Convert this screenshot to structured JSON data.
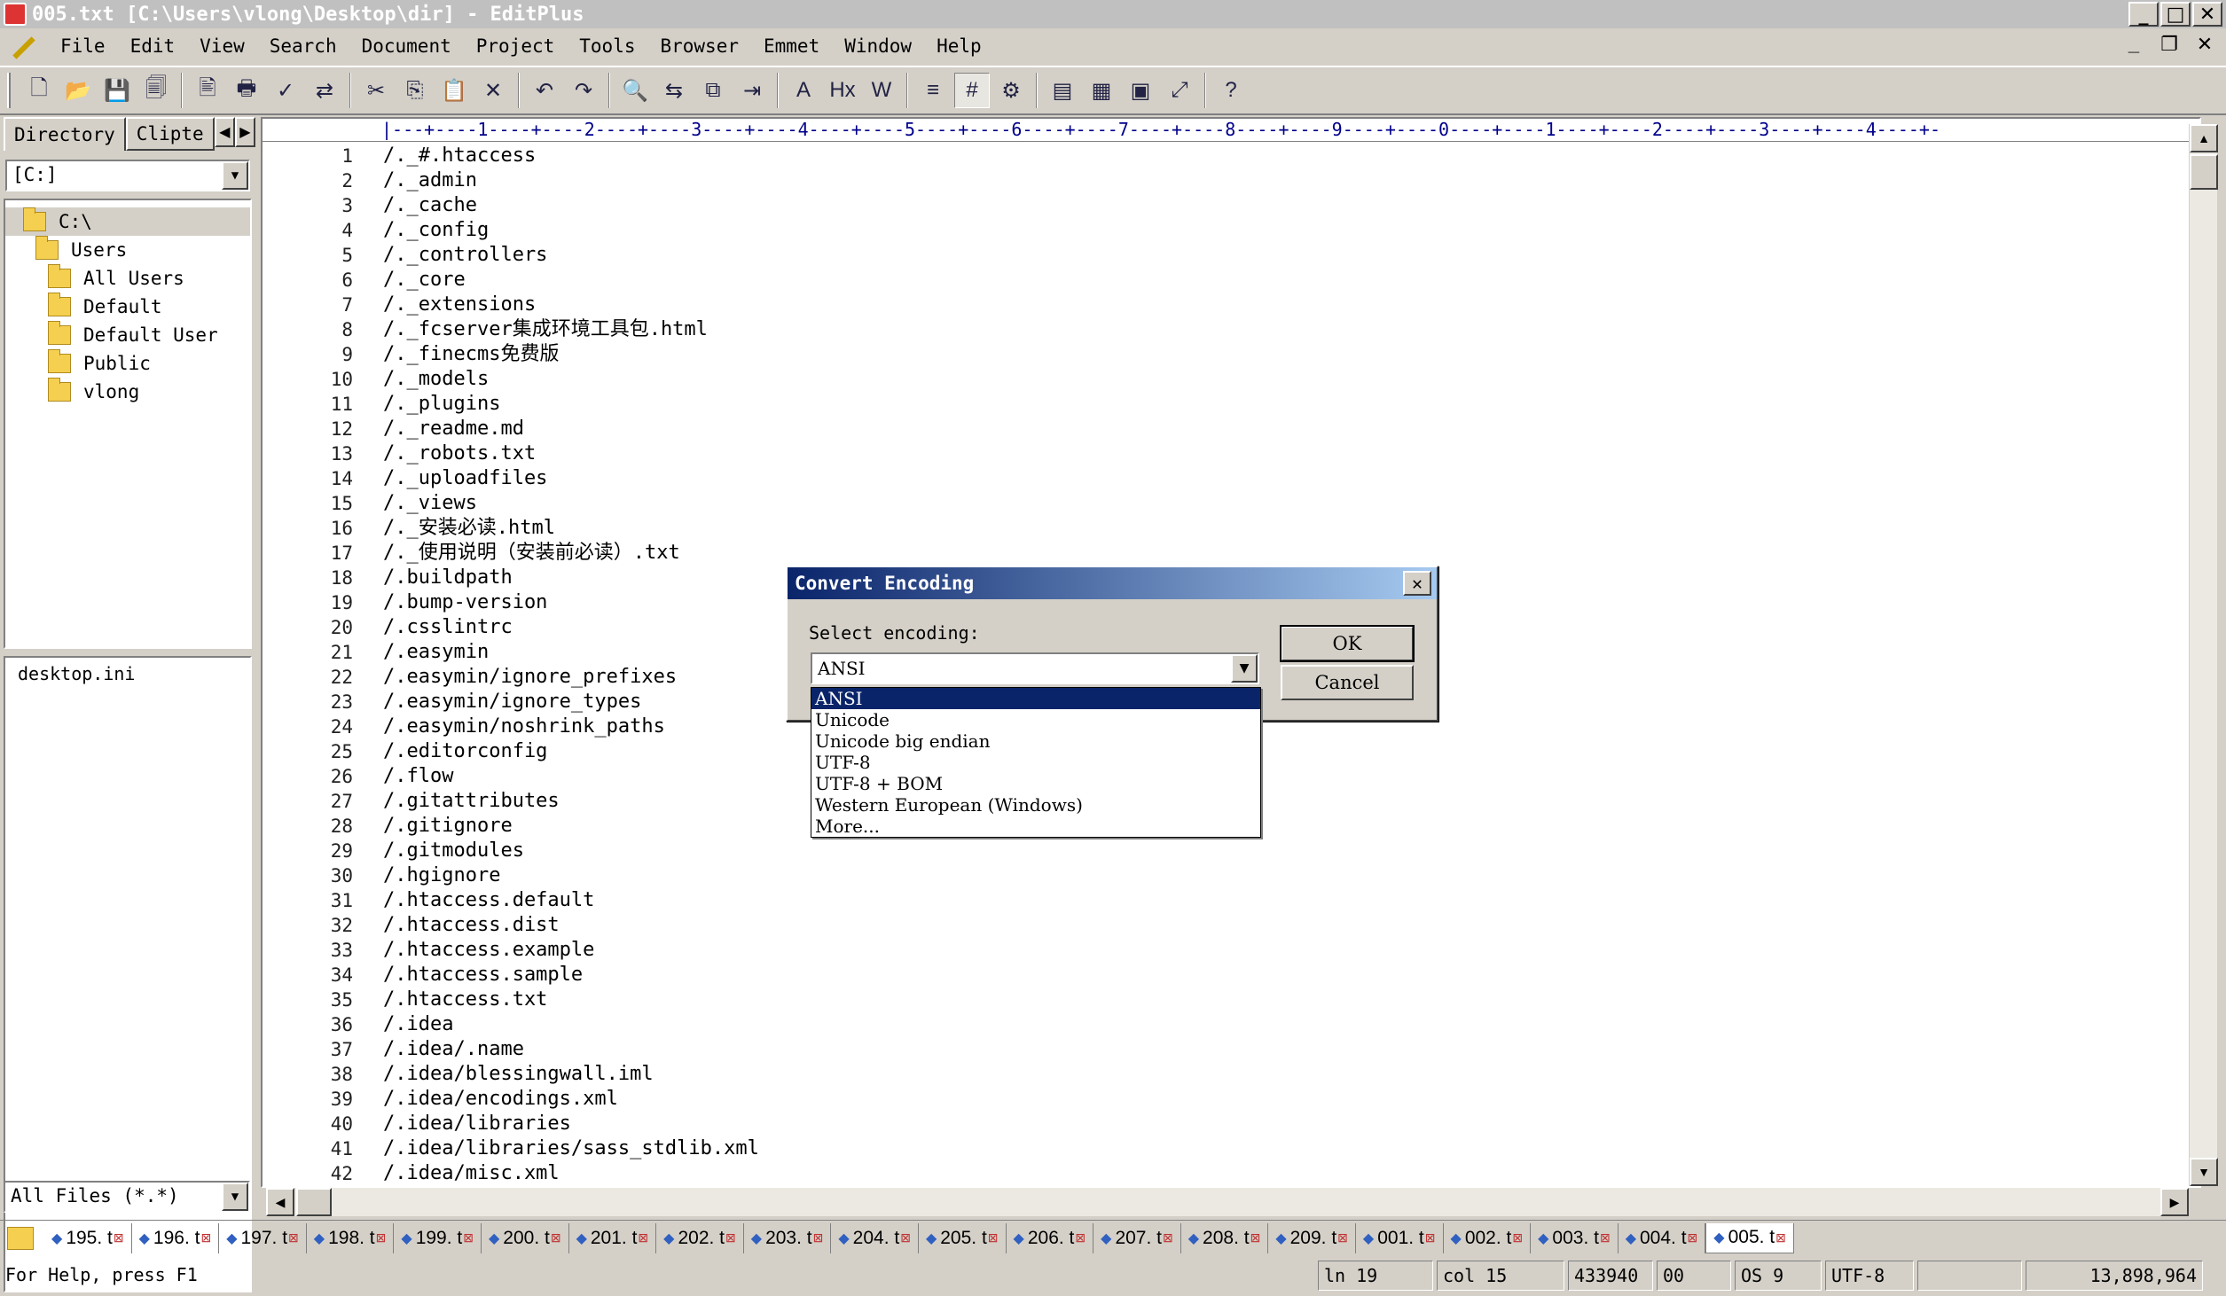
{
  "window": {
    "title": "005.txt [C:\\Users\\vlong\\Desktop\\dir] - EditPlus",
    "controls": [
      "_",
      "□",
      "✕"
    ],
    "mdi_controls": [
      "_",
      "❐",
      "✕"
    ]
  },
  "menu": [
    "File",
    "Edit",
    "View",
    "Search",
    "Document",
    "Project",
    "Tools",
    "Browser",
    "Emmet",
    "Window",
    "Help"
  ],
  "toolbar": {
    "icons": [
      {
        "name": "new-file-icon",
        "glyph": "🗋"
      },
      {
        "name": "open-folder-icon",
        "glyph": "📂"
      },
      {
        "name": "save-icon",
        "glyph": "💾"
      },
      {
        "name": "save-all-icon",
        "glyph": "🗐"
      },
      {
        "name": "print-preview-icon",
        "glyph": "🖹"
      },
      {
        "name": "print-icon",
        "glyph": "🖶"
      },
      {
        "name": "spell-check-icon",
        "glyph": "✓"
      },
      {
        "name": "browser-preview-icon",
        "glyph": "⇄"
      },
      {
        "name": "cut-icon",
        "glyph": "✂"
      },
      {
        "name": "copy-icon",
        "glyph": "⎘"
      },
      {
        "name": "paste-icon",
        "glyph": "📋"
      },
      {
        "name": "delete-icon",
        "glyph": "✕"
      },
      {
        "name": "undo-icon",
        "glyph": "↶"
      },
      {
        "name": "redo-icon",
        "glyph": "↷"
      },
      {
        "name": "find-icon",
        "glyph": "🔍"
      },
      {
        "name": "replace-icon",
        "glyph": "⇆"
      },
      {
        "name": "find-in-files-icon",
        "glyph": "⧉"
      },
      {
        "name": "go-to-line-icon",
        "glyph": "⇥"
      },
      {
        "name": "font-icon",
        "glyph": "A"
      },
      {
        "name": "html-toolbar-icon",
        "glyph": "Hx"
      },
      {
        "name": "word-wrap-icon",
        "glyph": "W"
      },
      {
        "name": "line-number-icon",
        "glyph": "≡"
      },
      {
        "name": "ruler-icon",
        "glyph": "#"
      },
      {
        "name": "preferences-icon",
        "glyph": "⚙"
      },
      {
        "name": "directory-window-icon",
        "glyph": "▤"
      },
      {
        "name": "cliptext-window-icon",
        "glyph": "▦"
      },
      {
        "name": "output-window-icon",
        "glyph": "▣"
      },
      {
        "name": "fullscreen-icon",
        "glyph": "⤢"
      },
      {
        "name": "help-icon",
        "glyph": "?"
      }
    ]
  },
  "left_panel": {
    "tabs": [
      "Directory",
      "Clipte"
    ],
    "drive": "[C:]",
    "tree": [
      {
        "label": "C:\\",
        "indent": 0,
        "selected": true
      },
      {
        "label": "Users",
        "indent": 1
      },
      {
        "label": "All Users",
        "indent": 2
      },
      {
        "label": "Default",
        "indent": 2
      },
      {
        "label": "Default User",
        "indent": 2
      },
      {
        "label": "Public",
        "indent": 2
      },
      {
        "label": "vlong",
        "indent": 2
      }
    ],
    "files": [
      "desktop.ini"
    ],
    "filter": "All Files (*.*)"
  },
  "editor": {
    "ruler": "|---+----1----+----2----+----3----+----4----+----5----+----6----+----7----+----8----+----9----+----0----+----1----+----2----+----3----+----4----+-",
    "lines": [
      "/._#.htaccess",
      "/._admin",
      "/._cache",
      "/._config",
      "/._controllers",
      "/._core",
      "/._extensions",
      "/._fcserver集成环境工具包.html",
      "/._finecms免费版",
      "/._models",
      "/._plugins",
      "/._readme.md",
      "/._robots.txt",
      "/._uploadfiles",
      "/._views",
      "/._安装必读.html",
      "/._使用说明（安装前必读）.txt",
      "/.buildpath",
      "/.bump-version",
      "/.csslintrc",
      "/.easymin",
      "/.easymin/ignore_prefixes",
      "/.easymin/ignore_types",
      "/.easymin/noshrink_paths",
      "/.editorconfig",
      "/.flow",
      "/.gitattributes",
      "/.gitignore",
      "/.gitmodules",
      "/.hgignore",
      "/.htaccess.default",
      "/.htaccess.dist",
      "/.htaccess.example",
      "/.htaccess.sample",
      "/.htaccess.txt",
      "/.idea",
      "/.idea/.name",
      "/.idea/blessingwall.iml",
      "/.idea/encodings.xml",
      "/.idea/libraries",
      "/.idea/libraries/sass_stdlib.xml",
      "/.idea/misc.xml"
    ]
  },
  "doc_tabs": [
    "195. t",
    "196. t",
    "197. t",
    "198. t",
    "199. t",
    "200. t",
    "201. t",
    "202. t",
    "203. t",
    "204. t",
    "205. t",
    "206. t",
    "207. t",
    "208. t",
    "209. t",
    "001. t",
    "002. t",
    "003. t",
    "004. t",
    "005. t"
  ],
  "active_doc_tab": "005. t",
  "status": {
    "help": "For Help, press F1",
    "line": "ln 19",
    "col": "col 15",
    "chars": "433940",
    "code": "00",
    "os": "OS 9",
    "encoding": "UTF-8",
    "size": "13,898,964"
  },
  "dialog": {
    "title": "Convert Encoding",
    "label": "Select encoding:",
    "value": "ANSI",
    "ok": "OK",
    "cancel": "Cancel",
    "options": [
      "ANSI",
      "Unicode",
      "Unicode big endian",
      "UTF-8",
      "UTF-8 + BOM",
      "Western European (Windows)",
      "More..."
    ],
    "selected_option": "ANSI"
  }
}
